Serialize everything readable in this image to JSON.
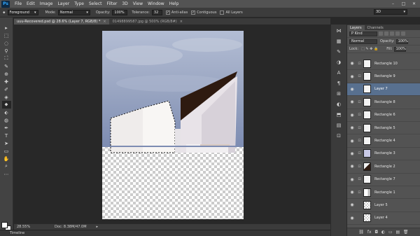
{
  "app": {
    "logo": "Ps"
  },
  "menu": [
    "File",
    "Edit",
    "Image",
    "Layer",
    "Type",
    "Select",
    "Filter",
    "3D",
    "View",
    "Window",
    "Help"
  ],
  "window_controls": {
    "minimize": "–",
    "maximize": "□",
    "close": "✕"
  },
  "options": {
    "tool_icon": "⬥",
    "preset": "Foreground",
    "mode_label": "Mode:",
    "mode_value": "Normal",
    "opacity_label": "Opacity:",
    "opacity_value": "100%",
    "tolerance_label": "Tolerance:",
    "tolerance_value": "32",
    "antialias_label": "Anti-alias",
    "contiguous_label": "Contiguous",
    "all_layers_label": "All Layers",
    "check_mark": "✓",
    "workspace": "3D",
    "dropdown_arrow": "▾"
  },
  "tabs": [
    {
      "label": "uuu-Recovered.psd @ 28.6% (Layer 7, RGB/8) *",
      "close": "×"
    },
    {
      "label": "01498899587.jpg @ 500% (RGB/8#)",
      "close": "×"
    }
  ],
  "tools": [
    "▸",
    "⬚",
    "◌",
    "⚲",
    "⛶",
    "✎",
    "⊕",
    "✚",
    "✐",
    "◈",
    "⬥",
    "⬖",
    "◍",
    "✒",
    "T",
    "➤",
    "▭",
    "✋",
    "⌕",
    "⋯"
  ],
  "status": {
    "zoom": "28.55%",
    "doc": "Doc: 8.38M/47.0M",
    "arrow": "▸"
  },
  "timeline": {
    "label": "Timeline"
  },
  "mini_icons": [
    "⋈",
    "▦",
    "✎",
    "◑",
    "A",
    "¶",
    "⊞",
    "◐",
    "⬒",
    "▤",
    "⊡"
  ],
  "layers_panel": {
    "tab_layers": "Layers",
    "tab_channels": "Channels",
    "kind_label": "P Kind",
    "blend_mode": "Normal",
    "opacity_label": "Opacity:",
    "opacity_value": "100%",
    "lock_label": "Lock:",
    "lock_icons": "⬚ ✎ ✥ 🔒",
    "fill_label": "Fill:",
    "fill_value": "100%",
    "eye": "◉",
    "link": "⊡",
    "layers": [
      {
        "name": "Rectangle 10",
        "thumb": "white",
        "active": false
      },
      {
        "name": "Rectangle 9",
        "thumb": "white",
        "active": false
      },
      {
        "name": "Layer 7",
        "thumb": "white",
        "active": true
      },
      {
        "name": "Rectangle 8",
        "thumb": "white",
        "active": false
      },
      {
        "name": "Rectangle 6",
        "thumb": "white",
        "active": false
      },
      {
        "name": "Rectangle 5",
        "thumb": "white",
        "active": false
      },
      {
        "name": "Rectangle 4",
        "thumb": "white",
        "active": false
      },
      {
        "name": "Rectangle 3",
        "thumb": "lav",
        "active": false
      },
      {
        "name": "Rectangle 2",
        "thumb": "dark",
        "active": false
      },
      {
        "name": "Rectangle 7",
        "thumb": "white",
        "active": false
      },
      {
        "name": "Rectangle 1",
        "thumb": "corner",
        "active": false
      },
      {
        "name": "Layer 5",
        "thumb": "check",
        "active": false
      },
      {
        "name": "Layer 4",
        "thumb": "check",
        "active": false
      }
    ],
    "footer_icons": [
      "⛓",
      "fx",
      "◘",
      "◐",
      "▭",
      "▤",
      "🗑"
    ]
  },
  "colors": {
    "accent_selected": "#58708f",
    "ui_panel": "#535353",
    "ui_dark": "#282828",
    "sky_top": "#9fadc9",
    "sky_bottom": "#7f8fb5",
    "roof_dark": "#2e1a10",
    "wall_light": "#f2f0f0"
  }
}
